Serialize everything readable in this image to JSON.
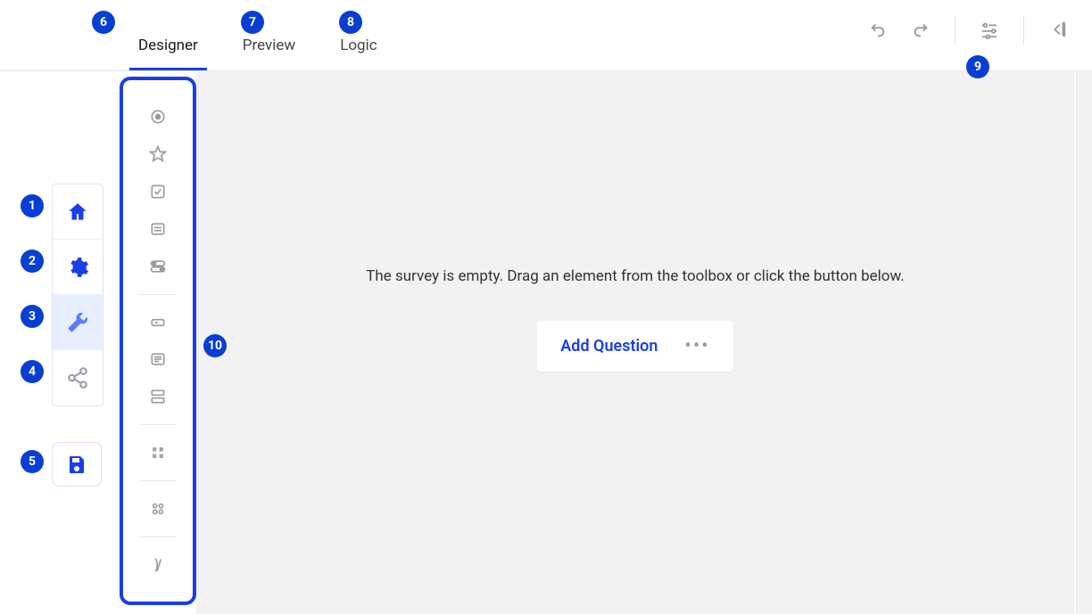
{
  "tabs": {
    "designer": "Designer",
    "preview": "Preview",
    "logic": "Logic"
  },
  "canvas": {
    "empty_message": "The survey is empty. Drag an element from the toolbox or click the button below.",
    "add_question_label": "Add Question"
  },
  "leftbar": {
    "home": "home",
    "settings": "settings",
    "build": "build",
    "share": "share",
    "save": "save"
  },
  "topactions": {
    "undo": "undo",
    "redo": "redo",
    "settings": "settings-panel",
    "collapse": "collapse-panel"
  },
  "toolbox_items": [
    "radiogroup",
    "rating",
    "checkbox",
    "dropdown",
    "boolean",
    "text-single",
    "comment",
    "multipletext",
    "matrix",
    "matrixdropdown",
    "expression"
  ],
  "callouts": [
    "1",
    "2",
    "3",
    "4",
    "5",
    "6",
    "7",
    "8",
    "9",
    "10"
  ]
}
